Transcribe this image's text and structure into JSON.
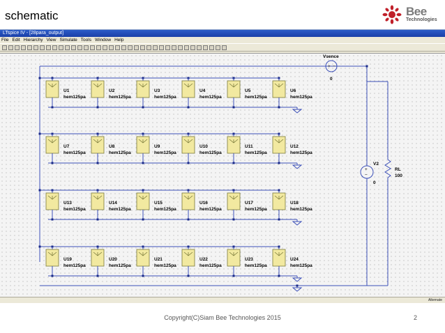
{
  "slide": {
    "title": "schematic",
    "page_number": "2",
    "copyright": "Copyright(C)Siam Bee Technologies 2015"
  },
  "logo": {
    "brand": "Bee",
    "sub": "Technologies"
  },
  "window": {
    "title": "LTspice IV - [28para_output]",
    "menu": [
      "File",
      "Edit",
      "Hierarchy",
      "View",
      "Simulate",
      "Tools",
      "Window",
      "Help"
    ],
    "status_right": "Alternate"
  },
  "schematic": {
    "vsence": {
      "name": "Vsence",
      "value": "0"
    },
    "v2": {
      "name": "V2",
      "value": "0"
    },
    "rl": {
      "name": "RL",
      "value": "100"
    },
    "panels": [
      {
        "ref": "U1",
        "val": "hem125pa"
      },
      {
        "ref": "U2",
        "val": "hem125pa"
      },
      {
        "ref": "U3",
        "val": "hem125pa"
      },
      {
        "ref": "U4",
        "val": "hem125pa"
      },
      {
        "ref": "U5",
        "val": "hem125pa"
      },
      {
        "ref": "U6",
        "val": "hem125pa"
      },
      {
        "ref": "U7",
        "val": "hem125pa"
      },
      {
        "ref": "U8",
        "val": "hem125pa"
      },
      {
        "ref": "U9",
        "val": "hem125pa"
      },
      {
        "ref": "U10",
        "val": "hem125pa"
      },
      {
        "ref": "U11",
        "val": "hem125pa"
      },
      {
        "ref": "U12",
        "val": "hem125pa"
      },
      {
        "ref": "U13",
        "val": "hem125pa"
      },
      {
        "ref": "U14",
        "val": "hem125pa"
      },
      {
        "ref": "U15",
        "val": "hem125pa"
      },
      {
        "ref": "U16",
        "val": "hem125pa"
      },
      {
        "ref": "U17",
        "val": "hem125pa"
      },
      {
        "ref": "U18",
        "val": "hem125pa"
      },
      {
        "ref": "U19",
        "val": "hem125pa"
      },
      {
        "ref": "U20",
        "val": "hem125pa"
      },
      {
        "ref": "U21",
        "val": "hem125pa"
      },
      {
        "ref": "U22",
        "val": "hem125pa"
      },
      {
        "ref": "U23",
        "val": "hem125pa"
      },
      {
        "ref": "U24",
        "val": "hem125pa"
      }
    ]
  },
  "colors": {
    "wire": "#3b4fb8",
    "panel_fill": "#f2e9a0",
    "panel_stroke": "#7a7a3a",
    "node": "#1a2a88"
  }
}
